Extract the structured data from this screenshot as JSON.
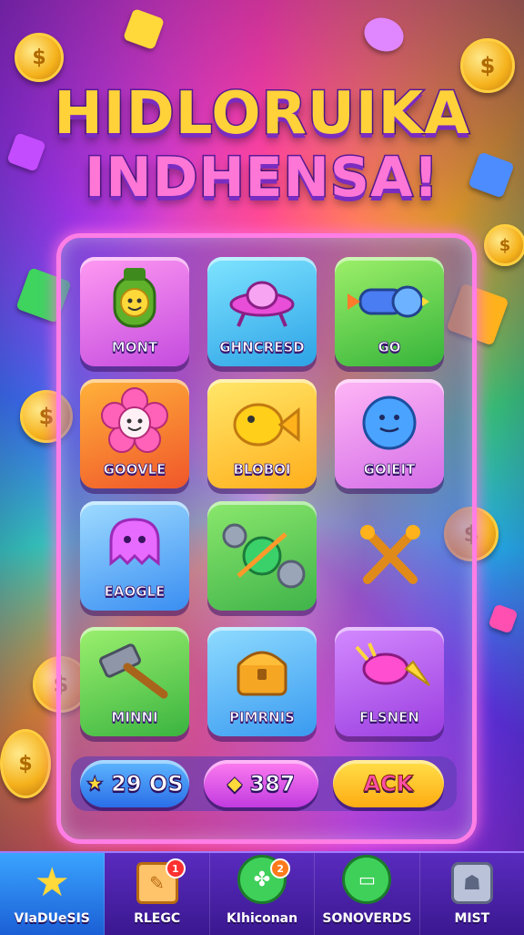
{
  "title": {
    "line1": "HIDLORUIKA",
    "line2": "INDHENSA!"
  },
  "grid": {
    "tiles": [
      {
        "label": "MONT",
        "icon": "grenade-icon"
      },
      {
        "label": "GHNCRESD",
        "icon": "ufo-icon"
      },
      {
        "label": "GO",
        "icon": "rocket-icon"
      },
      {
        "label": "GOOVLE",
        "icon": "flower-icon"
      },
      {
        "label": "BLOBOI",
        "icon": "fish-icon"
      },
      {
        "label": "GOIEIT",
        "icon": "ball-icon"
      },
      {
        "label": "EAOGLE",
        "icon": "ghost-icon"
      },
      {
        "label": "",
        "icon": "gear-gem-icon"
      },
      {
        "label": "",
        "icon": "crossed-tools-icon"
      },
      {
        "label": "MINNI",
        "icon": "hammer-icon"
      },
      {
        "label": "PIMRNIS",
        "icon": "treasure-chest-icon"
      },
      {
        "label": "FLSNEN",
        "icon": "drill-icon"
      }
    ]
  },
  "currency": {
    "stars": "29 OS",
    "gems": "387",
    "action": "ACK"
  },
  "nav": {
    "items": [
      {
        "label": "VIaDUeSIS",
        "icon": "star-icon",
        "badge": ""
      },
      {
        "label": "RLEGC",
        "icon": "map-icon",
        "badge": "1"
      },
      {
        "label": "KIhiconan",
        "icon": "lucky-clover-icon",
        "badge": "2"
      },
      {
        "label": "SONOVERDS",
        "icon": "ticket-icon",
        "badge": ""
      },
      {
        "label": "MIST",
        "icon": "puzzle-icon",
        "badge": ""
      }
    ]
  },
  "colors": {
    "accent": "#ff7ee6",
    "nav_bg": "#3a1890",
    "active_tab": "#1b5fd6",
    "gold": "#ffd23a"
  }
}
